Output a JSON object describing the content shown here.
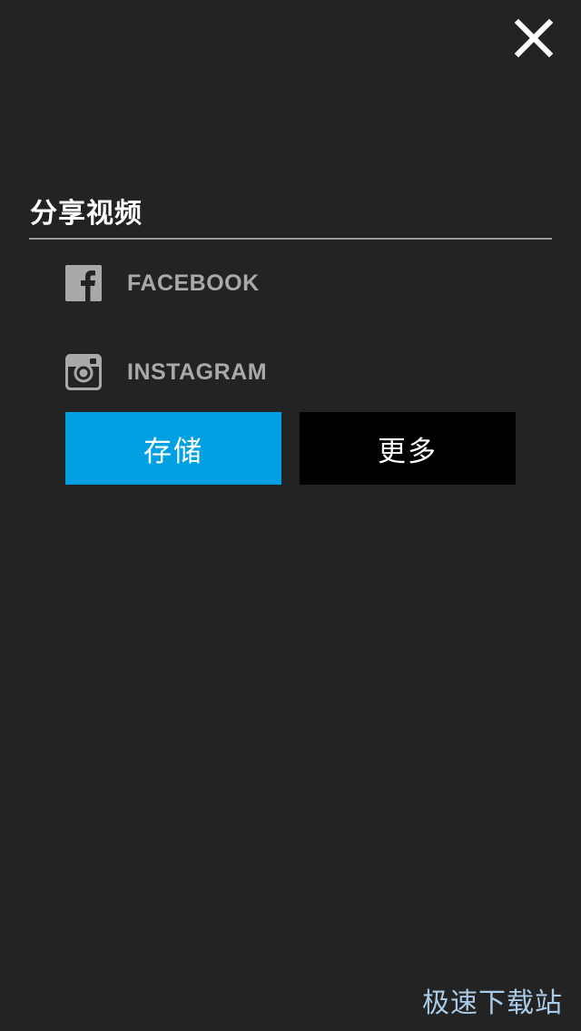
{
  "dialog": {
    "close_icon": "close-icon",
    "title": "分享视频"
  },
  "share_options": [
    {
      "icon": "facebook-icon",
      "label": "FACEBOOK"
    },
    {
      "icon": "instagram-icon",
      "label": "INSTAGRAM"
    }
  ],
  "actions": {
    "save_label": "存储",
    "more_label": "更多"
  },
  "watermark": {
    "text": "极速下载站"
  },
  "colors": {
    "background": "#232323",
    "save_button": "#00a0e3",
    "more_button": "#000000",
    "icon_gray": "#a9a9a9",
    "divider": "#9a9a9a",
    "watermark": "#a9cbe8"
  }
}
